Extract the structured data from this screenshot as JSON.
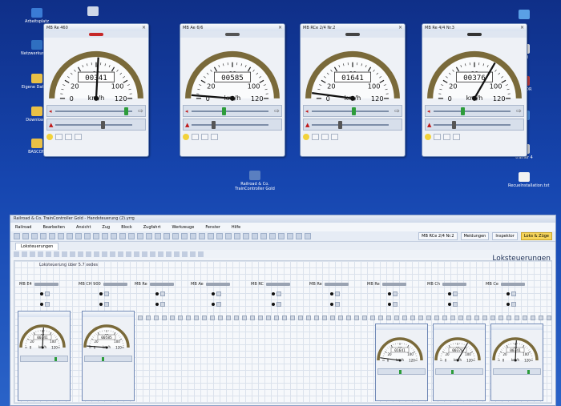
{
  "desktop": {
    "icons_left": [
      {
        "label": "Arbeitsplatz",
        "color": "#3a7bd5"
      },
      {
        "label": "Netzwerkumgebung",
        "color": "#2f6fc0"
      },
      {
        "label": "Eigene Dateien",
        "color": "#e9c046"
      },
      {
        "label": "Downloads",
        "color": "#e9c046"
      },
      {
        "label": "BASCOM",
        "color": "#e9c046"
      }
    ],
    "icons_right": [
      {
        "label": "",
        "color": "#5aa0e6"
      },
      {
        "label": "iPad",
        "color": "#e9e9e9"
      },
      {
        "label": "EDITOR",
        "color": "#c23b3b"
      },
      {
        "label": "",
        "color": "#4a8de0"
      },
      {
        "label": "trainer 4",
        "color": "#d8d8d8"
      },
      {
        "label": "RecueInstallation.txt",
        "color": "#f2f2f2"
      }
    ],
    "center_icon": {
      "label": "Railroad & Co. TrainController Gold",
      "color": "#5a7fc0"
    }
  },
  "throttles": [
    {
      "title": "MB Re 460",
      "speed_counter": "00341",
      "needle": 62,
      "slider": 0.95,
      "loco_color": "#c62828"
    },
    {
      "title": "MB Ae 6/6",
      "speed_counter": "00585",
      "needle": 3,
      "slider": 0.42,
      "loco_color": "#555555"
    },
    {
      "title": "MB RCe 2/4 Nr.2",
      "speed_counter": "01641",
      "needle": 5,
      "slider": 0.55,
      "loco_color": "#444444"
    },
    {
      "title": "MB Re 4/4 Nr.3",
      "speed_counter": "00376",
      "needle": 80,
      "slider": 0.38,
      "loco_color": "#333333"
    }
  ],
  "gauge": {
    "unit": "km/h",
    "ticks": [
      "0",
      "20",
      "40",
      "60",
      "80",
      "100",
      "120"
    ]
  },
  "app": {
    "title": "Railroad & Co. TrainController Gold - Handsteuerung (2).yrrg",
    "menu": [
      "Railroad",
      "Bearbeiten",
      "Ansicht",
      "Zug",
      "Block",
      "Zugfahrt",
      "Werkzeuge",
      "Fenster",
      "Hilfe"
    ],
    "toolbar_right": [
      "MB RCe 2/4 Nr.2",
      "Meldungen",
      "Inspektor",
      "Loks & Züge"
    ],
    "tab": "Loksteuerungen",
    "panel_title": "Loksteuerungen",
    "sub_label": "Loksteuerung über 5.7 xedes",
    "locos": [
      "MB E4",
      "MB CH 900",
      "MB Re",
      "MB Ae",
      "MB RC",
      "MB Re",
      "MB Re",
      "MB Ch",
      "MB Ce"
    ]
  }
}
